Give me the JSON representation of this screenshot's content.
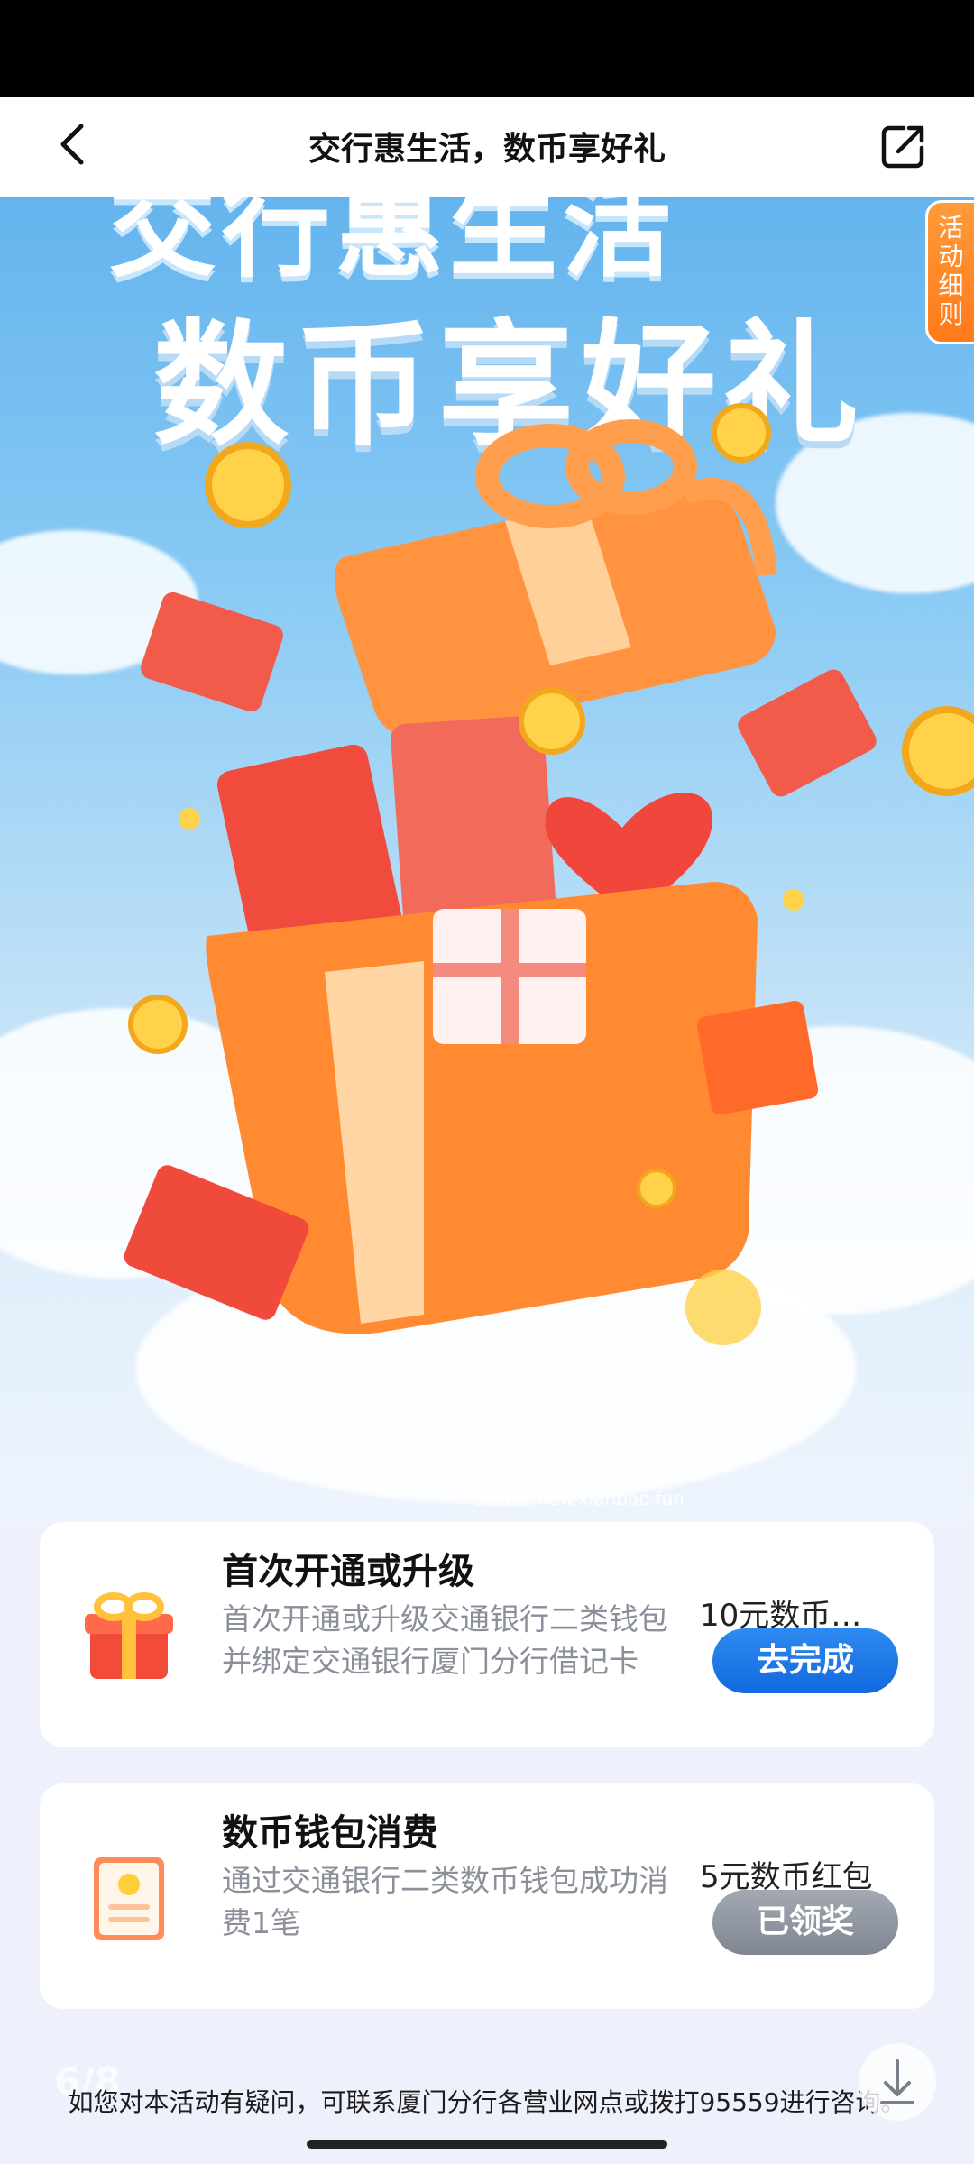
{
  "nav": {
    "title": "交行惠生活，数币享好礼",
    "back_icon": "chevron-left-icon",
    "share_icon": "share-external-icon"
  },
  "hero": {
    "headline_line1": "交行惠生活",
    "headline_line2": "数币享好礼",
    "rules_tab": [
      "活",
      "动",
      "细",
      "则"
    ],
    "watermark": "线报酷-new.xianbao.fun"
  },
  "tasks": [
    {
      "title": "首次开通或升级",
      "desc": "首次开通或升级交通银行二类钱包并绑定交通银行厦门分行借记卡",
      "reward": "10元数币…",
      "button": "去完成",
      "icon": "gift-box-icon"
    },
    {
      "title": "数币钱包消费",
      "desc": "通过交通银行二类数币钱包成功消费1笔",
      "reward": "5元数币红包",
      "button": "已领奖",
      "icon": "receipt-icon"
    }
  ],
  "footer": {
    "note": "如您对本活动有疑问，可联系厦门分行各营业网点或拨打95559进行咨询。",
    "page_indicator": "6/8"
  },
  "colors": {
    "accent_blue": "#1169df",
    "disabled_gray": "#7f8691",
    "rules_orange": "#ff7a1a"
  }
}
